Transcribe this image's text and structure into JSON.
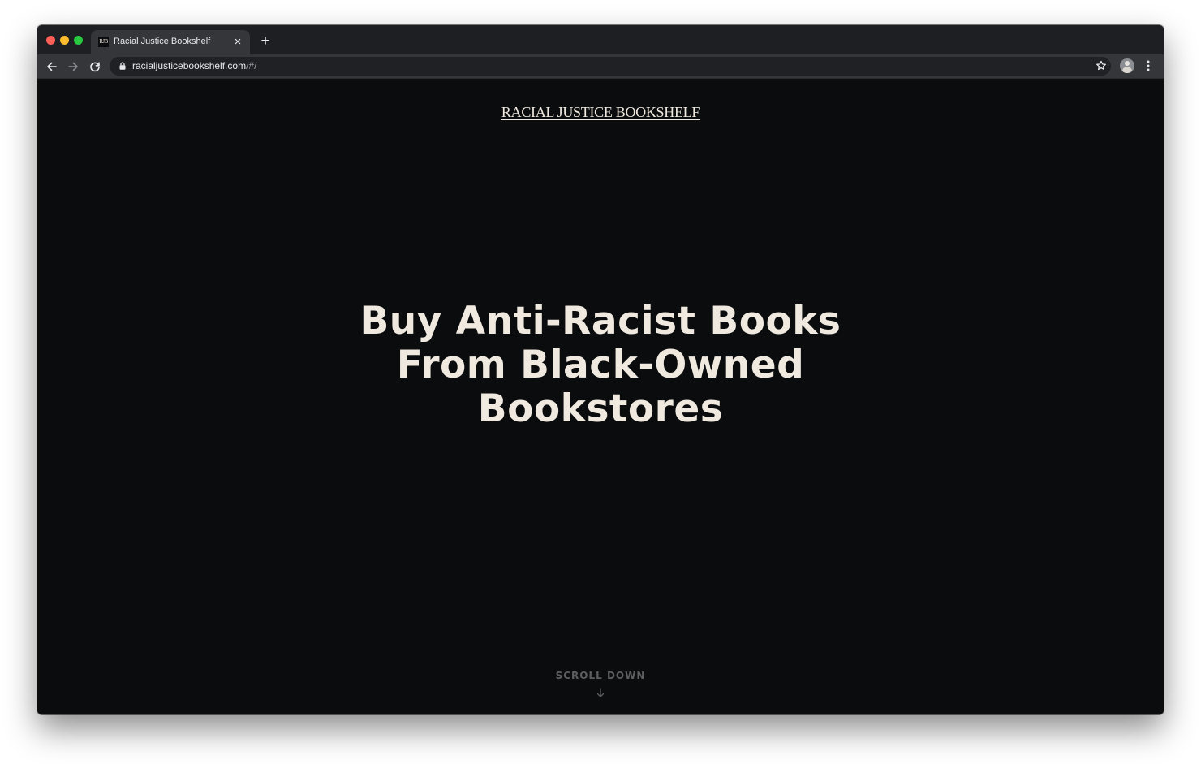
{
  "browser": {
    "tab": {
      "favicon_text": "RJB",
      "title": "Racial Justice Bookshelf",
      "close_glyph": "×"
    },
    "new_tab_glyph": "+",
    "address": {
      "host": "racialjusticebookshelf.com",
      "path": "/#/"
    },
    "icons": [
      "back-arrow-icon",
      "forward-arrow-icon",
      "reload-icon",
      "lock-icon",
      "star-icon",
      "avatar",
      "kebab-menu-icon"
    ]
  },
  "page": {
    "logo": "RACIAL JUSTICE BOOKSHELF",
    "hero_lines": [
      "Buy Anti-Racist Books",
      "From Black-Owned",
      "Bookstores"
    ],
    "scroll_label": "SCROLL DOWN",
    "colors": {
      "background": "#0b0c0e",
      "text": "#efe9df",
      "muted": "#5d5e61"
    }
  }
}
